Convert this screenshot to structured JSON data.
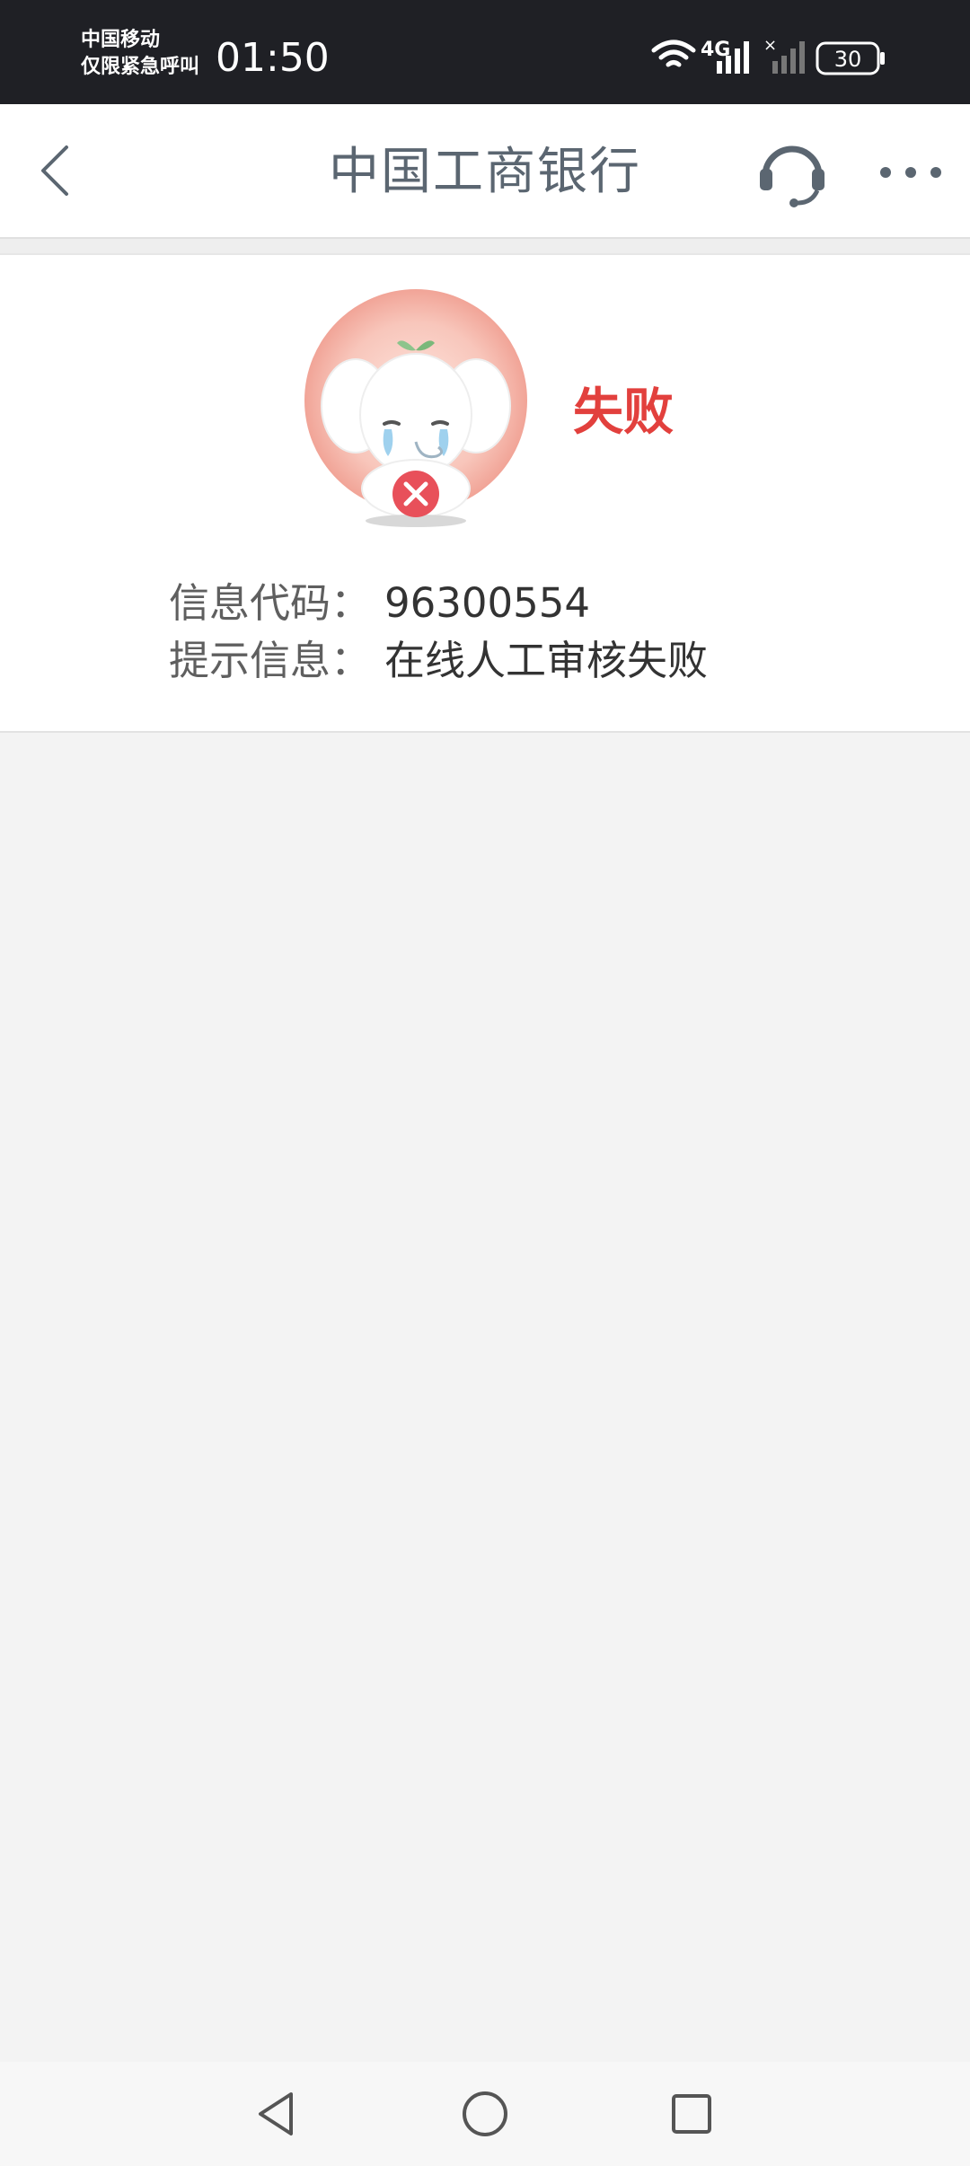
{
  "status_bar": {
    "carrier_line1": "中国移动",
    "carrier_line2": "仅限紧急呼叫",
    "time": "01:50",
    "network": "4G",
    "battery": "30"
  },
  "nav": {
    "title": "中国工商银行",
    "back_icon": "chevron-left-icon",
    "support_icon": "headset-icon",
    "more_icon": "more-dots-icon"
  },
  "result": {
    "status": "失败",
    "code_label": "信息代码：",
    "code_value": "96300554",
    "message_label": "提示信息：",
    "message_value": "在线人工审核失败"
  },
  "colors": {
    "status_bar_bg": "#1f2025",
    "failure_red": "#e2403d",
    "nav_text": "#5b6671",
    "page_bg": "#f3f3f3"
  },
  "system_nav": {
    "back_icon": "triangle-back-icon",
    "home_icon": "circle-home-icon",
    "recents_icon": "square-recents-icon"
  }
}
